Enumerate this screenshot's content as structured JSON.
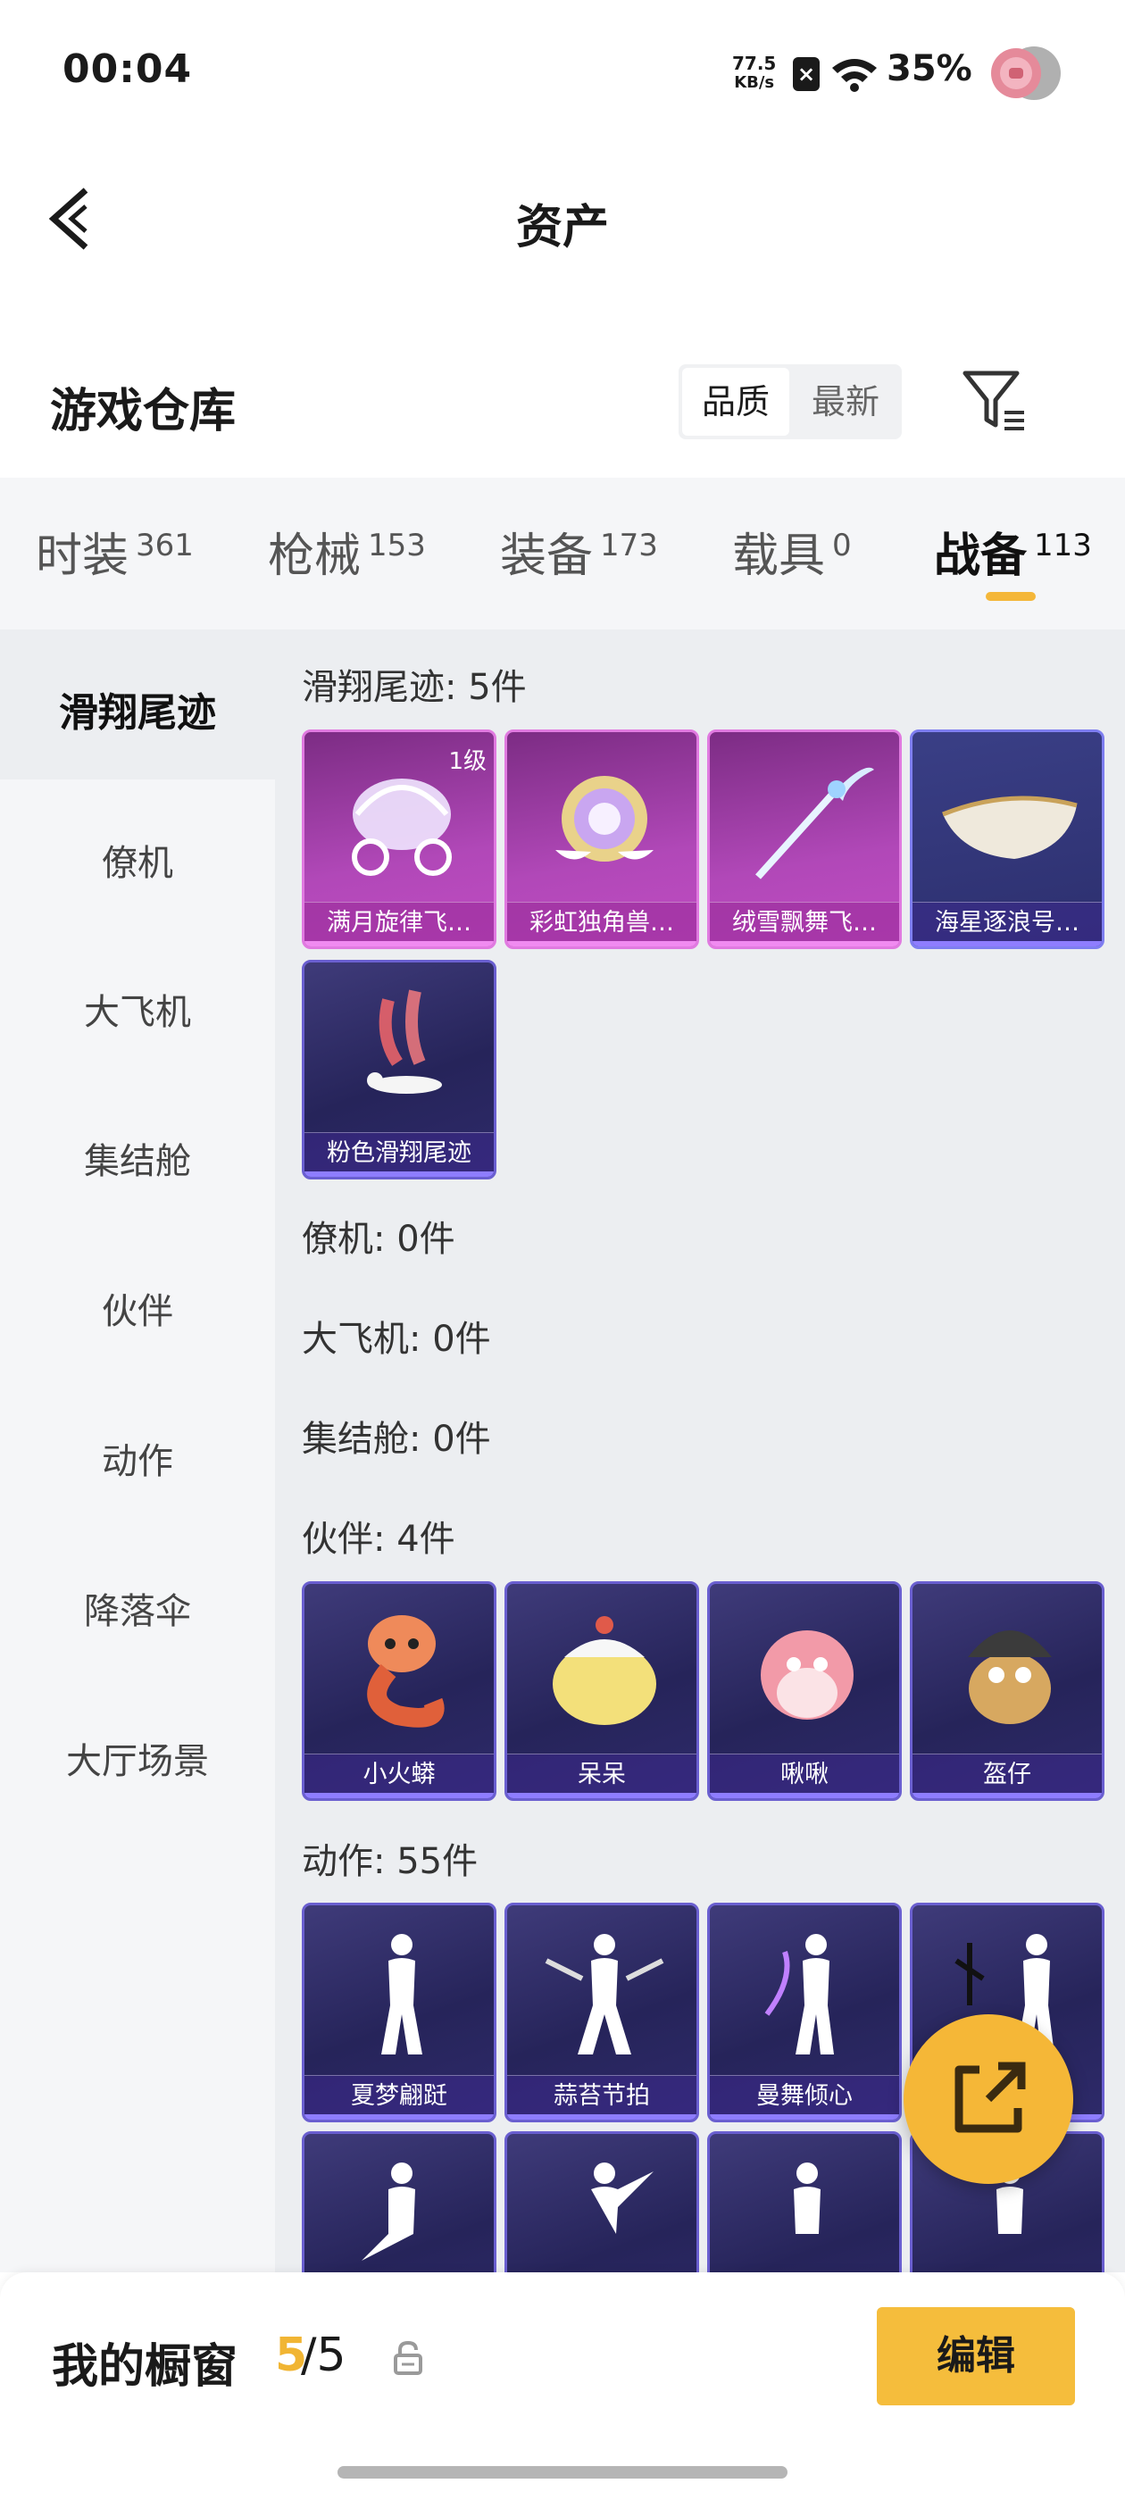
{
  "status_bar": {
    "time": "00:04",
    "net_speed_value": "77.5",
    "net_speed_unit": "KB/s",
    "battery": "35%"
  },
  "header": {
    "title": "资产"
  },
  "warehouse": {
    "title": "游戏仓库",
    "sort_options": [
      "品质",
      "最新"
    ]
  },
  "tabs": [
    {
      "label": "时装",
      "count": "361"
    },
    {
      "label": "枪械",
      "count": "153"
    },
    {
      "label": "装备",
      "count": "173"
    },
    {
      "label": "载具",
      "count": "0"
    },
    {
      "label": "战备",
      "count": "113"
    }
  ],
  "sidebar": [
    "滑翔尾迹",
    "僚机",
    "大飞机",
    "集结舱",
    "伙伴",
    "动作",
    "降落伞",
    "大厅场景"
  ],
  "sections": {
    "glide": {
      "title": "滑翔尾迹: 5件",
      "items": [
        "满月旋律飞…",
        "彩虹独角兽…",
        "绒雪飘舞飞…",
        "海星逐浪号…",
        "粉色滑翔尾迹"
      ],
      "level": "1级"
    },
    "wingman": {
      "title": "僚机: 0件"
    },
    "plane": {
      "title": "大飞机: 0件"
    },
    "pod": {
      "title": "集结舱: 0件"
    },
    "partner": {
      "title": "伙伴: 4件",
      "items": [
        "小火蟒",
        "呆呆",
        "啾啾",
        "盔仔"
      ]
    },
    "emote": {
      "title": "动作: 55件",
      "items": [
        "夏梦翩跹",
        "蒜苔节拍",
        "曼舞倾心"
      ]
    }
  },
  "bottom": {
    "showcase_label": "我的橱窗",
    "showcase_current": "5",
    "showcase_total": "/5",
    "edit_label": "编辑"
  },
  "colors": {
    "accent": "#f5bd3c",
    "card_purple": "#2e2a6a",
    "card_pink": "#b148b8"
  }
}
